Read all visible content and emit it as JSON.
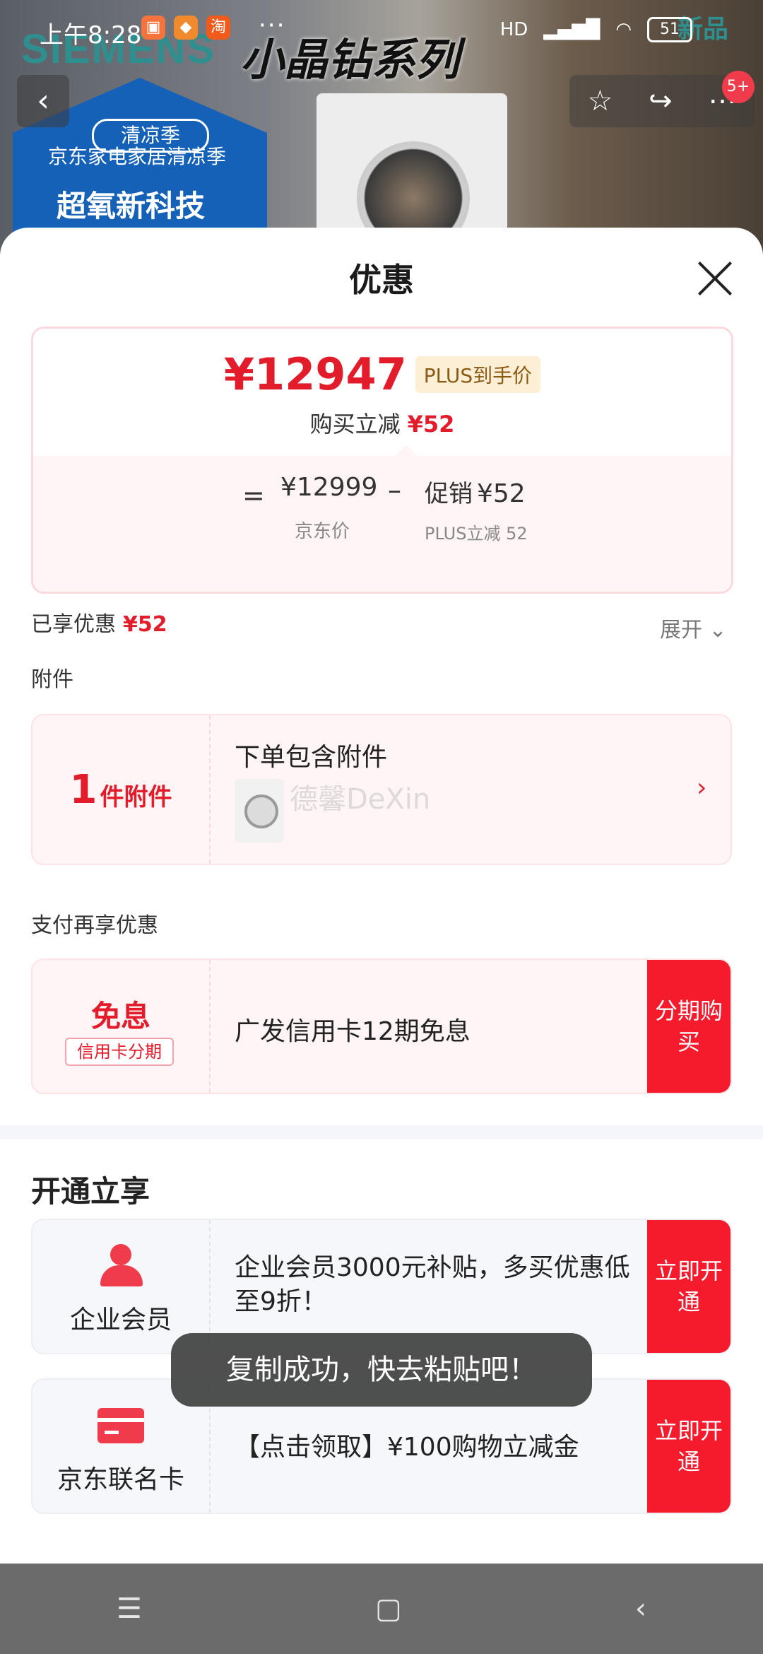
{
  "status_bar": {
    "time": "上午8:28",
    "app_icon_3": "淘",
    "dots": "···",
    "network": "HD",
    "battery": "51"
  },
  "background": {
    "brand": "SIEMENS",
    "series": "小晶钻系列",
    "badge_tag": "清凉季",
    "badge_line": "京东家电家居清凉季",
    "badge_title": "超氧新科技",
    "new_label": "新品",
    "notification_count": "5+",
    "icons": [
      "back-icon",
      "star-icon",
      "share-icon",
      "more-icon"
    ]
  },
  "sheet": {
    "title": "优惠",
    "price": {
      "final": "¥12947",
      "plus_tag": "PLUS到手价",
      "sub_label": "购买立减",
      "sub_value": "¥52",
      "eq": "=",
      "jd_price": "¥12999",
      "jd_label": "京东价",
      "minus": "–",
      "promo_label": "促销",
      "promo_value": "¥52",
      "promo_detail": "PLUS立减 52"
    },
    "enjoyed_label": "已享优惠",
    "enjoyed_value": "¥52",
    "expand_label": "展开 ⌄",
    "accessory_section": "附件",
    "accessory": {
      "count": "1",
      "count_unit": "件附件",
      "title": "下单包含附件",
      "watermark": "德馨DeXin",
      "arrow": "›"
    },
    "pay_section": "支付再享优惠",
    "pay": {
      "badge": "免息",
      "badge_sub": "信用卡分期",
      "text": "广发信用卡12期免息",
      "button": "分期购买"
    },
    "open_title": "开通立享",
    "members": [
      {
        "label": "企业会员",
        "text": "企业会员3000元补贴，多买优惠低至9折！",
        "button": "立即开通"
      },
      {
        "label": "京东联名卡",
        "text": "【点击领取】¥100购物立减金",
        "button": "立即开通"
      }
    ]
  },
  "toast": "复制成功，快去粘贴吧！",
  "nav_bar": [
    "☰",
    "▢",
    "‹"
  ],
  "colors": {
    "accent": "#e31c2b",
    "button": "#f51b2c"
  }
}
